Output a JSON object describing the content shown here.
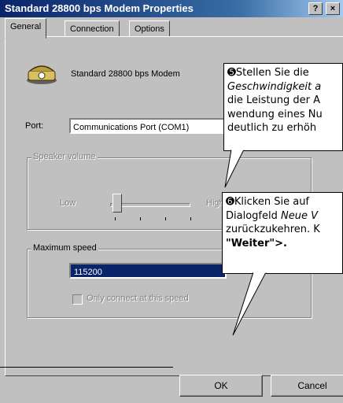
{
  "window": {
    "title": "Standard 28800 bps Modem Properties",
    "help_label": "?",
    "close_label": "×"
  },
  "tabs": [
    {
      "label": "General"
    },
    {
      "label": "Connection"
    },
    {
      "label": "Options"
    }
  ],
  "modem": {
    "name": "Standard 28800 bps Modem"
  },
  "port": {
    "label": "Port:",
    "value": "Communications Port (COM1)"
  },
  "speaker_volume": {
    "title": "Speaker volume",
    "low_label": "Low",
    "high_label": "High"
  },
  "maximum_speed": {
    "title": "Maximum speed",
    "value": "115200",
    "only_connect_label": "Only connect at this speed"
  },
  "buttons": {
    "ok": "OK",
    "cancel": "Cancel"
  },
  "callout1": {
    "number": "➎",
    "line1": "Stellen Sie die ",
    "line2": "Geschwindigkeit a",
    "line3": "die Leistung der A",
    "line4": "wendung eines Nu",
    "line5": "deutlich zu erhöh"
  },
  "callout2": {
    "number": "➏",
    "line1": "Klicken Sie auf",
    "line2a": "Dialogfeld ",
    "line2b": "Neue V",
    "line3": "zurückzukehren. K",
    "line4": "\"Weiter\">."
  }
}
